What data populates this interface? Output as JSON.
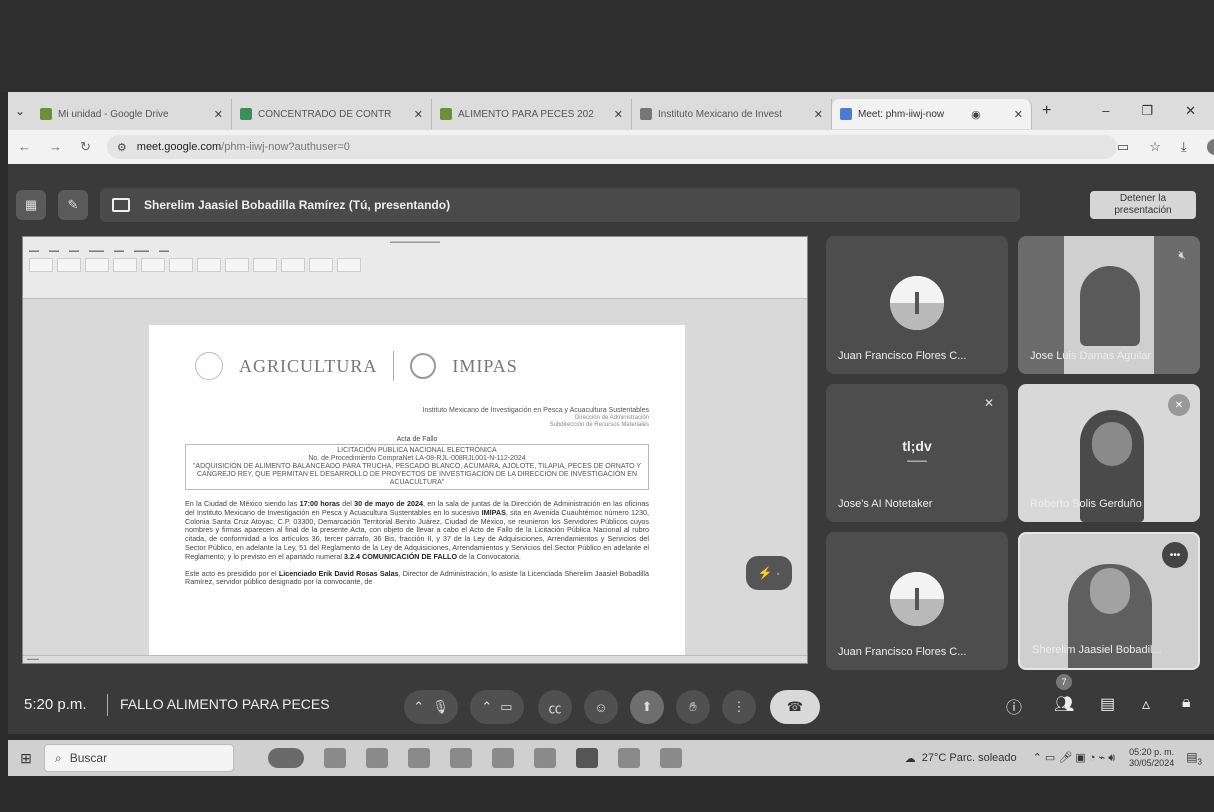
{
  "browser": {
    "tabs": [
      {
        "label": "Mi unidad - Google Drive",
        "color": "#6b8f3c"
      },
      {
        "label": "CONCENTRADO DE CONTR",
        "color": "#3a8f5a"
      },
      {
        "label": "ALIMENTO PARA PECES 202",
        "color": "#6b8f3c"
      },
      {
        "label": "Instituto Mexicano de Invest",
        "color": "#777777"
      },
      {
        "label": "Meet: phm-iiwj-now",
        "color": "#4a7bd0"
      }
    ],
    "url_domain": "meet.google.com",
    "url_path": "/phm-iiwj-now?authuser=0"
  },
  "meet": {
    "presenter_label": "Sherelim Jaasiel Bobadilla Ramírez (Tú, presentando)",
    "stop_presenting": "Detener la presentación",
    "time": "5:20 p.m.",
    "meeting_title": "FALLO ALIMENTO PARA PECES",
    "participant_count": "7",
    "participants": [
      {
        "name": "Juan Francisco Flores C..."
      },
      {
        "name": "Jose Luis Damas Aguilar"
      },
      {
        "name": "Jose's AI Notetaker"
      },
      {
        "name": "Roberto Solis Gerduño"
      },
      {
        "name": "Juan Francisco Flores C..."
      },
      {
        "name": "Sherelim Jaasiel Bobadil..."
      }
    ],
    "notetaker_logo": "tl;dv"
  },
  "document": {
    "logo_agri": "AGRICULTURA",
    "logo_imipas": "IMIPAS",
    "institute": "Instituto Mexicano de Investigación en Pesca y Acuacultura Sustentables",
    "direccion": "Dirección de Administración",
    "subdireccion": "Subdirección de Recursos Materiales",
    "acta_title": "Acta de Fallo",
    "licitacion": "LICITACIÓN PÚBLICA NACIONAL ELECTRÓNICA",
    "procedimiento": "No. de Procedimiento CompraNet LA-08-RJL-008RJL001-N-112-2024",
    "objeto": "\"ADQUISICIÓN DE ALIMENTO BALANCEADO PARA TRUCHA, PESCADO BLANCO, ACUMARA, AJOLOTE, TILAPIA, PECES DE ORNATO Y CANGREJO REY, QUE PERMITAN EL DESARROLLO DE PROYECTOS DE INVESTIGACIÓN DE LA DIRECCIÓN DE INVESTIGACIÓN EN ACUACULTURA\"",
    "p1_a": "En la Ciudad de México siendo las ",
    "p1_hora": "17:00 horas",
    "p1_b": " del ",
    "p1_fecha": "30 de mayo de 2024",
    "p1_c": ", en la sala de juntas de la Dirección de Administración en las oficinas del Instituto Mexicano de Investigación en Pesca y Acuacultura Sustentables en lo sucesivo ",
    "p1_imipas": "IMIPAS",
    "p1_d": ", sita en Avenida Cuauhtémoc número 1230, Colonia Santa Cruz Atoyac, C.P. 03300, Demarcación Territorial Benito Juárez, Ciudad de México, se reunieron los Servidores Públicos cuyos nombres y firmas aparecen al final de la presente Acta, con objeto de llevar a cabo el Acto de Fallo de la Licitación Pública Nacional al rubro citada, de conformidad a los artículos 36, tercer párrafo, 36 Bis, fracción II, y 37 de la Ley de Adquisiciones, Arrendamientos y Servicios del Sector Público, en adelante la Ley, 51 del Reglamento de la Ley de Adquisiciones, Arrendamientos y Servicios del Sector Público en adelante el Reglamento; y lo previsto en el apartado numeral ",
    "p1_num": "3.2.4 COMUNICACIÓN DE FALLO",
    "p1_e": " de la Convocatoria.",
    "p2_a": "Este acto es presidido por el ",
    "p2_lic": "Licenciado Erik David Rosas Salas",
    "p2_b": ", Director de Administración, lo asiste la Licenciada Sherelim Jaasiel Bobadilla Ramírez, servidor público designado por la convocante, de"
  },
  "taskbar": {
    "search_placeholder": "Buscar",
    "weather": "27°C Parc. soleado",
    "clock_time": "05:20 p. m.",
    "clock_date": "30/05/2024",
    "notif_count": "3"
  }
}
